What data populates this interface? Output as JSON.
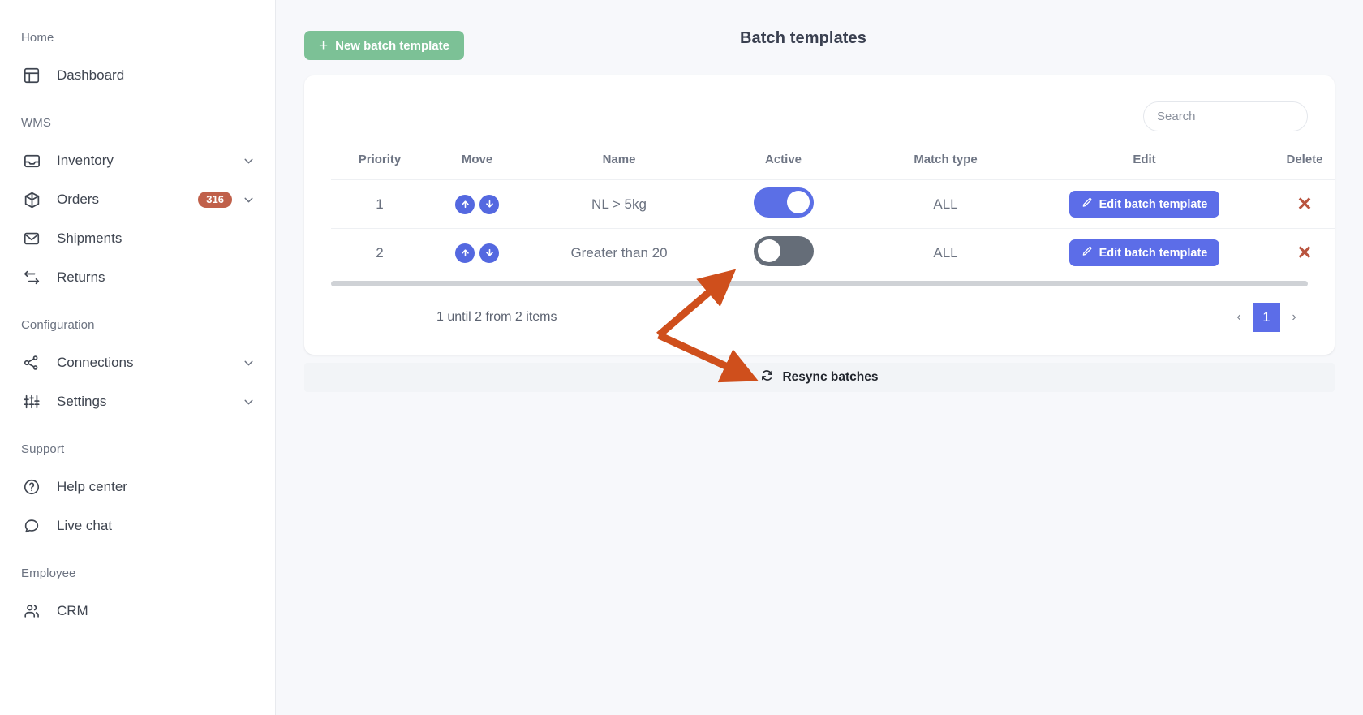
{
  "sidebar": {
    "sections": [
      {
        "label": "Home",
        "items": [
          {
            "label": "Dashboard",
            "icon": "layout-icon",
            "badge": null,
            "chevron": false
          }
        ]
      },
      {
        "label": "WMS",
        "items": [
          {
            "label": "Inventory",
            "icon": "inbox-icon",
            "badge": null,
            "chevron": true
          },
          {
            "label": "Orders",
            "icon": "box-icon",
            "badge": "316",
            "chevron": true
          },
          {
            "label": "Shipments",
            "icon": "envelope-icon",
            "badge": null,
            "chevron": false
          },
          {
            "label": "Returns",
            "icon": "return-arrows-icon",
            "badge": null,
            "chevron": false
          }
        ]
      },
      {
        "label": "Configuration",
        "items": [
          {
            "label": "Connections",
            "icon": "share-nodes-icon",
            "badge": null,
            "chevron": true
          },
          {
            "label": "Settings",
            "icon": "sliders-icon",
            "badge": null,
            "chevron": true
          }
        ]
      },
      {
        "label": "Support",
        "items": [
          {
            "label": "Help center",
            "icon": "question-circle-icon",
            "badge": null,
            "chevron": false
          },
          {
            "label": "Live chat",
            "icon": "chat-bubble-icon",
            "badge": null,
            "chevron": false
          }
        ]
      },
      {
        "label": "Employee",
        "items": [
          {
            "label": "CRM",
            "icon": "users-icon",
            "badge": null,
            "chevron": false
          }
        ]
      }
    ]
  },
  "header": {
    "new_button_label": "New batch template",
    "new_button_icon": "plus-icon",
    "title": "Batch templates"
  },
  "search": {
    "placeholder": "Search",
    "value": ""
  },
  "table": {
    "columns": [
      "Priority",
      "Move",
      "Name",
      "Active",
      "Match type",
      "Edit",
      "Delete"
    ],
    "rows": [
      {
        "priority": "1",
        "name": "NL > 5kg",
        "active": true,
        "match_type": "ALL",
        "edit_label": "Edit batch template",
        "delete_icon": "x-icon"
      },
      {
        "priority": "2",
        "name": "Greater than 20",
        "active": false,
        "match_type": "ALL",
        "edit_label": "Edit batch template",
        "delete_icon": "x-icon"
      }
    ]
  },
  "pagination": {
    "items_count": "1 until 2 from 2 items",
    "prev_label": "‹",
    "next_label": "›",
    "pages": [
      "1"
    ],
    "current_page": "1"
  },
  "footer": {
    "resync_label": "Resync batches",
    "resync_icon": "refresh-icon"
  },
  "colors": {
    "accent_blue": "#5c6de8",
    "accent_green": "#7cc196",
    "badge_red": "#c0604a",
    "delete_red": "#b9543f",
    "toggle_off": "#656d78",
    "annotation_orange": "#cf4f1c",
    "page_bg": "#f7f8fb"
  }
}
